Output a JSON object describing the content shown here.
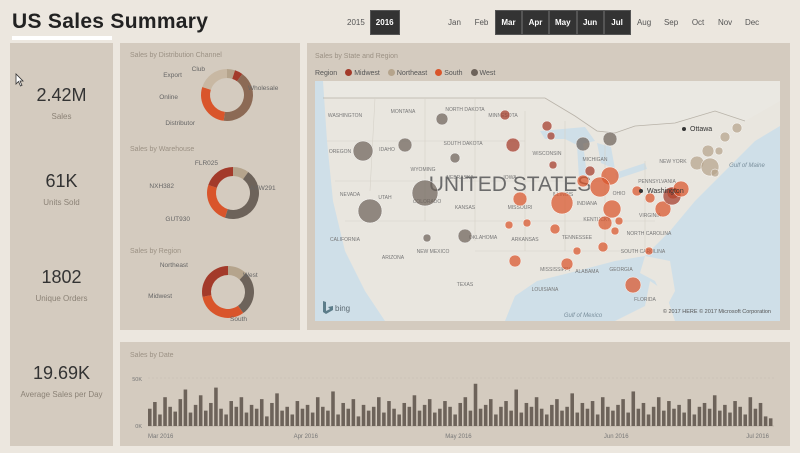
{
  "title": "US Sales Summary",
  "years": [
    {
      "label": "2015",
      "selected": false
    },
    {
      "label": "2016",
      "selected": true
    }
  ],
  "months": [
    {
      "label": "Jan",
      "selected": false
    },
    {
      "label": "Feb",
      "selected": false
    },
    {
      "label": "Mar",
      "selected": true
    },
    {
      "label": "Apr",
      "selected": true
    },
    {
      "label": "May",
      "selected": true
    },
    {
      "label": "Jun",
      "selected": true
    },
    {
      "label": "Jul",
      "selected": true
    },
    {
      "label": "Aug",
      "selected": false
    },
    {
      "label": "Sep",
      "selected": false
    },
    {
      "label": "Oct",
      "selected": false
    },
    {
      "label": "Nov",
      "selected": false
    },
    {
      "label": "Dec",
      "selected": false
    }
  ],
  "kpis": [
    {
      "value": "2.42M",
      "label": "Sales"
    },
    {
      "value": "61K",
      "label": "Units Sold"
    },
    {
      "value": "1802",
      "label": "Unique Orders"
    },
    {
      "value": "19.69K",
      "label": "Average Sales per Day"
    }
  ],
  "colors": {
    "midwest": "#a33a2a",
    "northeast": "#b5a48c",
    "south": "#d9552b",
    "west": "#6d635a"
  },
  "donuts": {
    "channel": {
      "title": "Sales by Distribution Channel",
      "labels": [
        "Club",
        "Export",
        "Online",
        "Distributor",
        "Wholesale"
      ],
      "slices": [
        {
          "name": "Club",
          "value": 5,
          "color": "#b5a48c"
        },
        {
          "name": "Export",
          "value": 5,
          "color": "#a33a2a"
        },
        {
          "name": "Wholesale",
          "value": 42,
          "color": "#8c6a55"
        },
        {
          "name": "Distributor",
          "value": 28,
          "color": "#d9552b"
        },
        {
          "name": "Online",
          "value": 20,
          "color": "#c8b8a3"
        }
      ]
    },
    "warehouse": {
      "title": "Sales by Warehouse",
      "labels": [
        "FLR025",
        "NXH382",
        "GUT930",
        "AXW291"
      ],
      "slices": [
        {
          "name": "FLR025",
          "value": 10,
          "color": "#b5a48c"
        },
        {
          "name": "AXW291",
          "value": 45,
          "color": "#6d635a"
        },
        {
          "name": "GUT930",
          "value": 25,
          "color": "#d9552b"
        },
        {
          "name": "NXH382",
          "value": 20,
          "color": "#a33a2a"
        }
      ]
    },
    "region": {
      "title": "Sales by Region",
      "labels": [
        "Northeast",
        "West",
        "Midwest",
        "South"
      ],
      "slices": [
        {
          "name": "Northeast",
          "value": 12,
          "color": "#b5a48c"
        },
        {
          "name": "West",
          "value": 28,
          "color": "#6d635a"
        },
        {
          "name": "South",
          "value": 32,
          "color": "#d9552b"
        },
        {
          "name": "Midwest",
          "value": 28,
          "color": "#a33a2a"
        }
      ]
    }
  },
  "map": {
    "title": "Sales by State and Region",
    "legend_title": "Region",
    "legend": [
      "Midwest",
      "Northeast",
      "South",
      "West"
    ],
    "country_label": "UNITED STATES",
    "cities": [
      "Ottawa",
      "Washington"
    ],
    "states": [
      "WASHINGTON",
      "MONTANA",
      "NORTH DAKOTA",
      "MINNESOTA",
      "OREGON",
      "IDAHO",
      "SOUTH DAKOTA",
      "WISCONSIN",
      "MICHIGAN",
      "WYOMING",
      "NEBRASKA",
      "IOWA",
      "NEVADA",
      "UTAH",
      "COLORADO",
      "KANSAS",
      "MISSOURI",
      "ILLINOIS",
      "INDIANA",
      "OHIO",
      "PENNSYLVANIA",
      "NEW YORK",
      "CALIFORNIA",
      "ARIZONA",
      "NEW MEXICO",
      "OKLAHOMA",
      "ARKANSAS",
      "TENNESSEE",
      "KENTUCKY",
      "VIRGINIA",
      "NORTH CAROLINA",
      "SOUTH CAROLINA",
      "GEORGIA",
      "ALABAMA",
      "MISSISSIPPI",
      "LOUISIANA",
      "TEXAS",
      "FLORIDA"
    ],
    "water": [
      "Gulf of Mexico",
      "Gulf of Maine"
    ],
    "bing": "bing",
    "copyright": "© 2017 HERE  © 2017 Microsoft Corporation"
  },
  "bars": {
    "title": "Sales by Date",
    "y_ticks": [
      "50K",
      "0K"
    ],
    "x_ticks": [
      "Mar 2016",
      "Apr 2016",
      "May 2016",
      "Jun 2016",
      "Jul 2016"
    ]
  },
  "chart_data": {
    "type": "bar",
    "title": "Sales by Date",
    "xlabel": "",
    "ylabel": "",
    "ylim": [
      0,
      50000
    ],
    "categories": [
      "2016-03-01",
      "2016-03-02",
      "2016-03-03",
      "2016-03-04",
      "2016-03-05",
      "2016-03-06",
      "2016-03-07",
      "2016-03-08",
      "2016-03-09",
      "2016-03-10",
      "2016-03-11",
      "2016-03-12",
      "2016-03-13",
      "2016-03-14",
      "2016-03-15",
      "2016-03-16",
      "2016-03-17",
      "2016-03-18",
      "2016-03-19",
      "2016-03-20",
      "2016-03-21",
      "2016-03-22",
      "2016-03-23",
      "2016-03-24",
      "2016-03-25",
      "2016-03-26",
      "2016-03-27",
      "2016-03-28",
      "2016-03-29",
      "2016-03-30",
      "2016-03-31",
      "2016-04-01",
      "2016-04-02",
      "2016-04-03",
      "2016-04-04",
      "2016-04-05",
      "2016-04-06",
      "2016-04-07",
      "2016-04-08",
      "2016-04-09",
      "2016-04-10",
      "2016-04-11",
      "2016-04-12",
      "2016-04-13",
      "2016-04-14",
      "2016-04-15",
      "2016-04-16",
      "2016-04-17",
      "2016-04-18",
      "2016-04-19",
      "2016-04-20",
      "2016-04-21",
      "2016-04-22",
      "2016-04-23",
      "2016-04-24",
      "2016-04-25",
      "2016-04-26",
      "2016-04-27",
      "2016-04-28",
      "2016-04-29",
      "2016-04-30",
      "2016-05-01",
      "2016-05-02",
      "2016-05-03",
      "2016-05-04",
      "2016-05-05",
      "2016-05-06",
      "2016-05-07",
      "2016-05-08",
      "2016-05-09",
      "2016-05-10",
      "2016-05-11",
      "2016-05-12",
      "2016-05-13",
      "2016-05-14",
      "2016-05-15",
      "2016-05-16",
      "2016-05-17",
      "2016-05-18",
      "2016-05-19",
      "2016-05-20",
      "2016-05-21",
      "2016-05-22",
      "2016-05-23",
      "2016-05-24",
      "2016-05-25",
      "2016-05-26",
      "2016-05-27",
      "2016-05-28",
      "2016-05-29",
      "2016-05-30",
      "2016-05-31",
      "2016-06-01",
      "2016-06-02",
      "2016-06-03",
      "2016-06-04",
      "2016-06-05",
      "2016-06-06",
      "2016-06-07",
      "2016-06-08",
      "2016-06-09",
      "2016-06-10",
      "2016-06-11",
      "2016-06-12",
      "2016-06-13",
      "2016-06-14",
      "2016-06-15",
      "2016-06-16",
      "2016-06-17",
      "2016-06-18",
      "2016-06-19",
      "2016-06-20",
      "2016-06-21",
      "2016-06-22",
      "2016-06-23",
      "2016-06-24",
      "2016-06-25",
      "2016-06-26",
      "2016-06-27",
      "2016-06-28",
      "2016-06-29",
      "2016-06-30",
      "2016-07-01"
    ],
    "values": [
      18000,
      25000,
      12000,
      30000,
      20000,
      15000,
      28000,
      38000,
      14000,
      22000,
      32000,
      16000,
      24000,
      40000,
      18000,
      12000,
      26000,
      20000,
      30000,
      14000,
      22000,
      18000,
      28000,
      10000,
      24000,
      34000,
      16000,
      20000,
      12000,
      26000,
      18000,
      22000,
      14000,
      30000,
      20000,
      16000,
      36000,
      12000,
      24000,
      18000,
      28000,
      10000,
      22000,
      16000,
      20000,
      30000,
      14000,
      26000,
      18000,
      12000,
      24000,
      20000,
      32000,
      16000,
      22000,
      28000,
      14000,
      18000,
      26000,
      20000,
      12000,
      24000,
      30000,
      16000,
      44000,
      18000,
      22000,
      28000,
      12000,
      20000,
      26000,
      16000,
      38000,
      14000,
      24000,
      20000,
      30000,
      18000,
      12000,
      22000,
      28000,
      16000,
      20000,
      34000,
      14000,
      24000,
      18000,
      26000,
      12000,
      30000,
      20000,
      16000,
      22000,
      28000,
      14000,
      36000,
      18000,
      24000,
      12000,
      20000,
      30000,
      16000,
      26000,
      18000,
      22000,
      14000,
      28000,
      12000,
      20000,
      24000,
      18000,
      32000,
      16000,
      22000,
      14000,
      26000,
      20000,
      12000,
      30000,
      18000,
      24000,
      10000,
      8000
    ]
  }
}
